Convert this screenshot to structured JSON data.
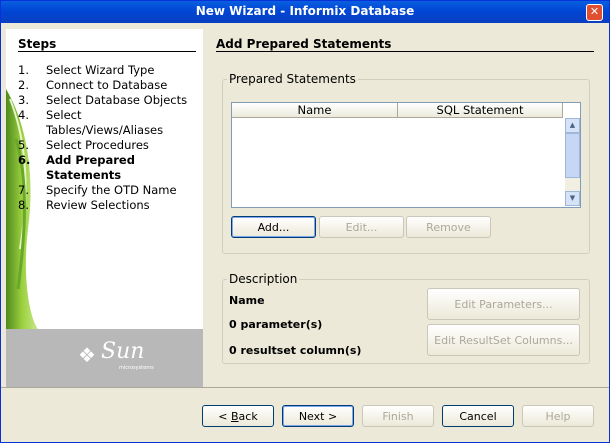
{
  "window": {
    "title": "New Wizard - Informix Database",
    "close_glyph": "✕"
  },
  "steps": {
    "heading": "Steps",
    "items": [
      {
        "num": "1.",
        "label": "Select Wizard Type"
      },
      {
        "num": "2.",
        "label": "Connect to Database"
      },
      {
        "num": "3.",
        "label": "Select Database Objects"
      },
      {
        "num": "4.",
        "label": "Select Tables/Views/Aliases"
      },
      {
        "num": "5.",
        "label": "Select Procedures"
      },
      {
        "num": "6.",
        "label": "Add Prepared Statements"
      },
      {
        "num": "7.",
        "label": "Specify the OTD Name"
      },
      {
        "num": "8.",
        "label": "Review Selections"
      }
    ],
    "active_index": 5
  },
  "logo": {
    "brand": "Sun",
    "subtext": "microsystems"
  },
  "main": {
    "title": "Add Prepared Statements",
    "prepared": {
      "legend": "Prepared Statements",
      "columns": [
        "Name",
        "SQL Statement"
      ],
      "add_label": "Add...",
      "edit_label": "Edit...",
      "remove_label": "Remove"
    },
    "description": {
      "legend": "Description",
      "name_label": "Name",
      "params_label": "0 parameter(s)",
      "resultset_label": "0 resultset column(s)",
      "edit_params_label": "Edit Parameters...",
      "edit_resultset_label": "Edit ResultSet Columns..."
    }
  },
  "footer": {
    "back_mnemonic": "B",
    "back_rest": "ack",
    "back_prefix": "< ",
    "next_label": "Next >",
    "finish_label": "Finish",
    "cancel_label": "Cancel",
    "help_label": "Help"
  }
}
